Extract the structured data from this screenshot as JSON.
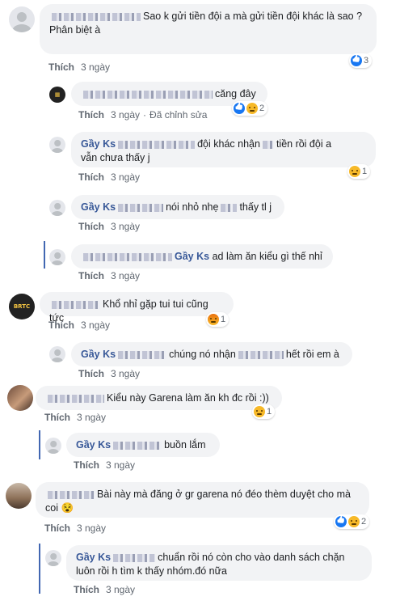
{
  "comments": [
    {
      "text": "Sao k gửi tiền đội a mà gửi tiền đội khác là sao ?\nPhân biệt à",
      "like": "Thích",
      "time": "3 ngày",
      "reaction_count": "3"
    },
    {
      "text": "căng đây",
      "like": "Thích",
      "time": "3 ngày",
      "edited": "Đã chỉnh sửa",
      "reaction_count": "2"
    },
    {
      "name": "Gầy Ks",
      "text_a": "đội khác nhận",
      "text_b": "tiền rồi đội a",
      "text_c": "vẫn chưa thấy j",
      "like": "Thích",
      "time": "3 ngày",
      "reaction_count": "1"
    },
    {
      "name": "Gầy Ks",
      "text_a": "nói nhỏ nhẹ",
      "text_b": "thấy tl j",
      "like": "Thích",
      "time": "3 ngày"
    },
    {
      "name": "Gầy Ks",
      "text": "ad làm ăn kiểu gì thế nhỉ",
      "like": "Thích",
      "time": "3 ngày"
    },
    {
      "text": "Khổ nhỉ gặp tui tui cũng tức",
      "like": "Thích",
      "time": "3 ngày",
      "reaction_count": "1",
      "avatar_label": "BRTC"
    },
    {
      "name": "Gầy Ks",
      "text_a": "chúng nó nhận",
      "text_b": "hết rồi em à",
      "like": "Thích",
      "time": "3 ngày"
    },
    {
      "text": "Kiểu này Garena làm ăn kh đc rồi :))",
      "like": "Thích",
      "time": "3 ngày",
      "reaction_count": "1"
    },
    {
      "name": "Gầy Ks",
      "text": "buồn lắm",
      "like": "Thích",
      "time": "3 ngày"
    },
    {
      "text_a": "Bài này mà đăng ở gr garena nó đéo thèm duyệt cho mà",
      "text_b": "coi 😵",
      "like": "Thích",
      "time": "3 ngày",
      "reaction_count": "2"
    },
    {
      "name": "Gầy Ks",
      "text_a": "chuẩn rồi nó còn cho vào danh sách chặn",
      "text_b": "luôn rồi h tìm k thấy nhóm.đó nữa",
      "like": "Thích",
      "time": "3 ngày"
    }
  ],
  "colors": {
    "link": "#385898",
    "bubble": "#f2f3f5",
    "meta": "#606770",
    "like_blue": "#1877f2"
  },
  "icons": [
    "like-reaction-icon",
    "haha-reaction-icon",
    "sad-reaction-icon",
    "angry-reaction-icon",
    "default-avatar-icon"
  ]
}
